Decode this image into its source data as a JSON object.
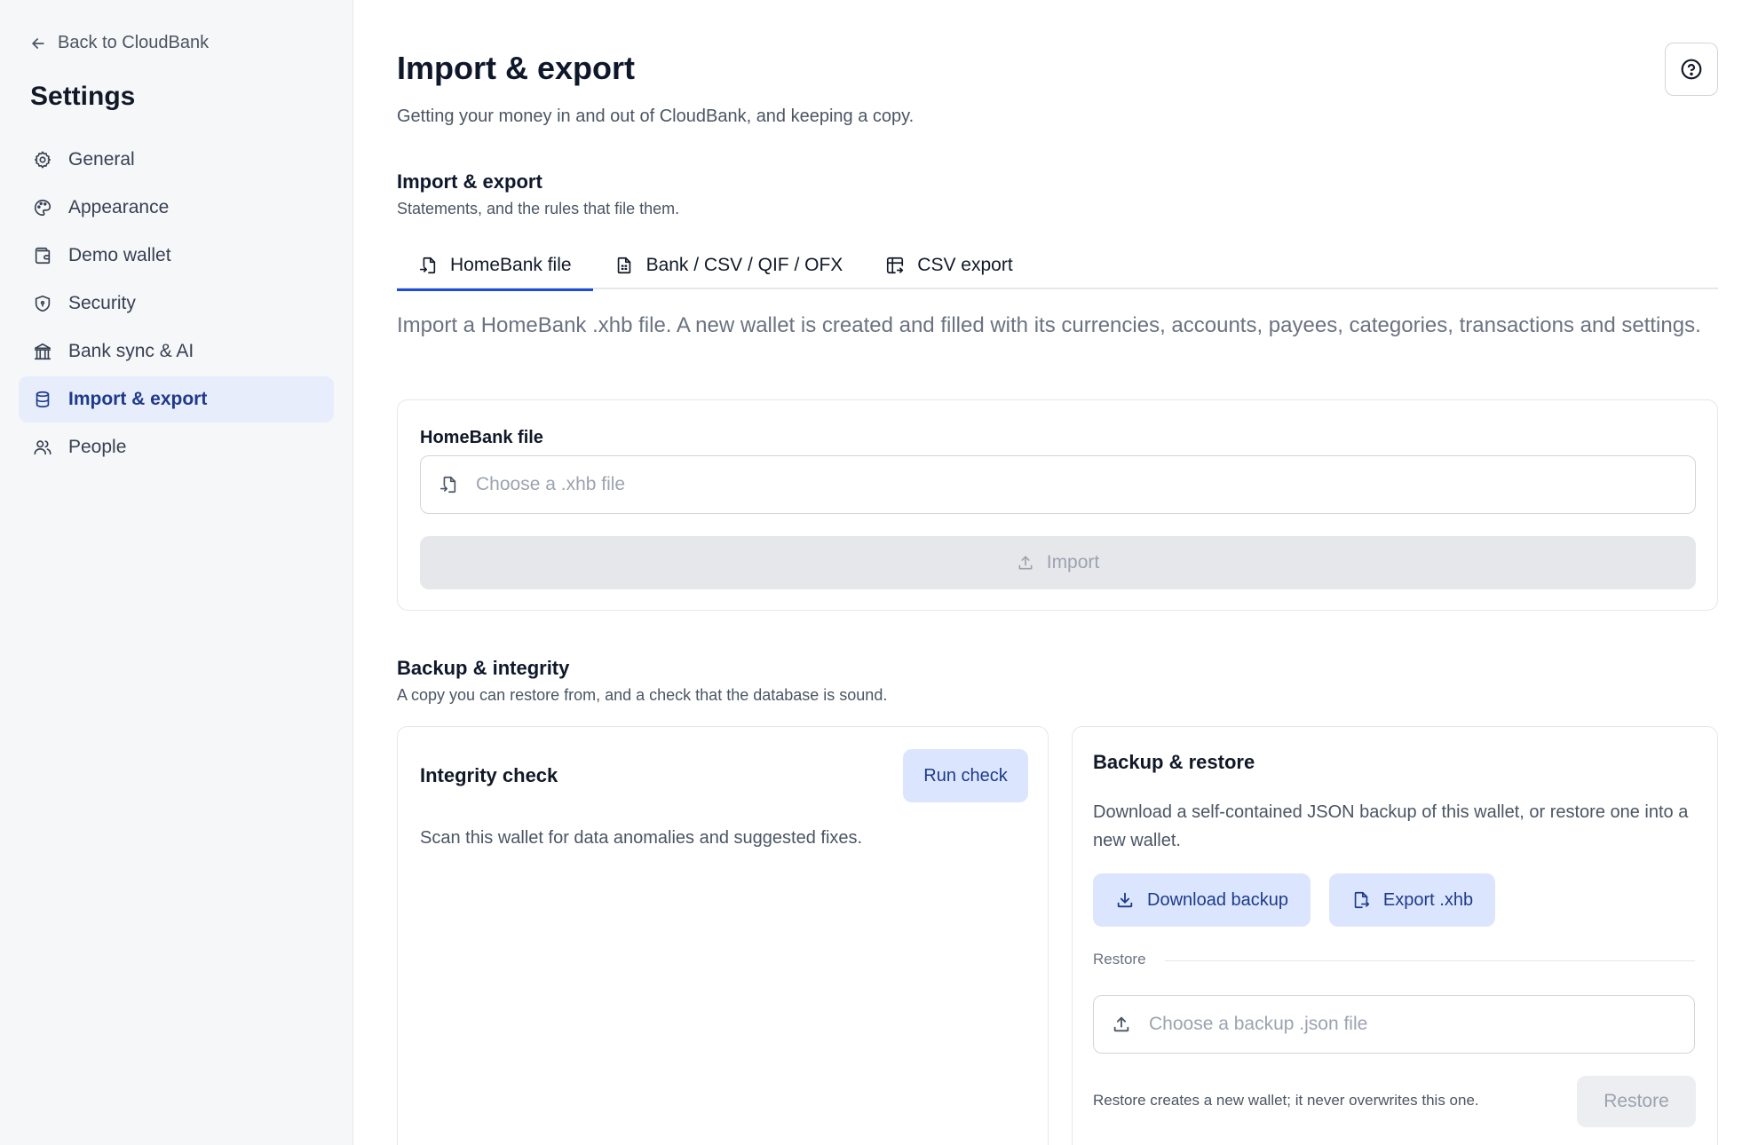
{
  "sidebar": {
    "back_label": "Back to CloudBank",
    "title": "Settings",
    "items": [
      {
        "label": "General",
        "icon": "gear-icon"
      },
      {
        "label": "Appearance",
        "icon": "palette-icon"
      },
      {
        "label": "Demo wallet",
        "icon": "wallet-icon"
      },
      {
        "label": "Security",
        "icon": "shield-icon"
      },
      {
        "label": "Bank sync & AI",
        "icon": "bank-icon"
      },
      {
        "label": "Import & export",
        "icon": "database-icon",
        "active": true
      },
      {
        "label": "People",
        "icon": "users-icon"
      }
    ]
  },
  "header": {
    "title": "Import & export",
    "subtitle": "Getting your money in and out of CloudBank, and keeping a copy.",
    "help_icon": "help-circle-icon"
  },
  "import_section": {
    "title": "Import & export",
    "description": "Statements, and the rules that file them.",
    "tabs": [
      {
        "label": "HomeBank file",
        "icon": "file-import-icon",
        "active": true
      },
      {
        "label": "Bank / CSV / QIF / OFX",
        "icon": "file-spreadsheet-icon"
      },
      {
        "label": "CSV export",
        "icon": "table-export-icon"
      }
    ],
    "tab_description": "Import a HomeBank .xhb file. A new wallet is created and filled with its currencies, accounts, payees, categories, transactions and settings.",
    "field_label": "HomeBank file",
    "file_placeholder": "Choose a .xhb file",
    "import_button": "Import"
  },
  "backup_section": {
    "title": "Backup & integrity",
    "description": "A copy you can restore from, and a check that the database is sound.",
    "integrity": {
      "title": "Integrity check",
      "run_button": "Run check",
      "text": "Scan this wallet for data anomalies and suggested fixes."
    },
    "backup": {
      "title": "Backup & restore",
      "text": "Download a self-contained JSON backup of this wallet, or restore one into a new wallet.",
      "download_button": "Download backup",
      "export_button": "Export .xhb",
      "restore_divider": "Restore",
      "restore_placeholder": "Choose a backup .json file",
      "restore_note": "Restore creates a new wallet; it never overwrites this one.",
      "restore_button": "Restore"
    }
  },
  "colors": {
    "accent": "#1d4ed8",
    "active_bg": "#e8edfc",
    "soft_button_bg": "#dbe6fe"
  }
}
